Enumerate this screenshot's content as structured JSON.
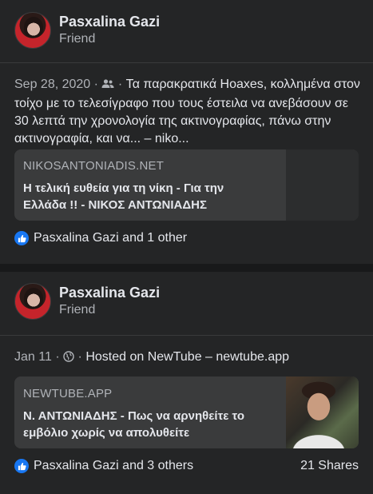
{
  "posts": [
    {
      "author": "Pasxalina Gazi",
      "relation": "Friend",
      "date": "Sep 28, 2020",
      "privacy_icon": "friends-icon",
      "text": "Τα παρακρατικά Hoaxes, κολλημένα στον τοίχο με το τελεσίγραφο που τους έστειλα να ανεβάσουν σε 30 λεπτά την χρονολογία της ακτινογραφίας, πάνω στην ακτινογραφία, και να... – niko...",
      "link": {
        "domain": "NIKOSANTONIADIS.NET",
        "title_line1": "Η τελική ευθεία για τη νίκη - Για την",
        "title_line2": "Ελλάδα !! - ΝΙΚΟΣ ΑΝΤΩΝΙΑΔΗΣ"
      },
      "reactions": "Pasxalina Gazi and 1 other",
      "shares": ""
    },
    {
      "author": "Pasxalina Gazi",
      "relation": "Friend",
      "date": "Jan 11",
      "privacy_icon": "globe-icon",
      "text": "Hosted on NewTube – newtube.app",
      "link": {
        "domain": "NEWTUBE.APP",
        "title_line1": "Ν. ΑΝΤΩΝΙΑΔΗΣ - Πως να αρνηθείτε το",
        "title_line2": "εμβόλιο χωρίς να απολυθείτε"
      },
      "reactions": "Pasxalina Gazi and 3 others",
      "shares": "21 Shares"
    }
  ],
  "colors": {
    "background": "#18191a",
    "card": "#242526",
    "link_box": "#3a3b3c",
    "secondary_text": "#b0b3b8",
    "like_blue": "#1877f2"
  }
}
